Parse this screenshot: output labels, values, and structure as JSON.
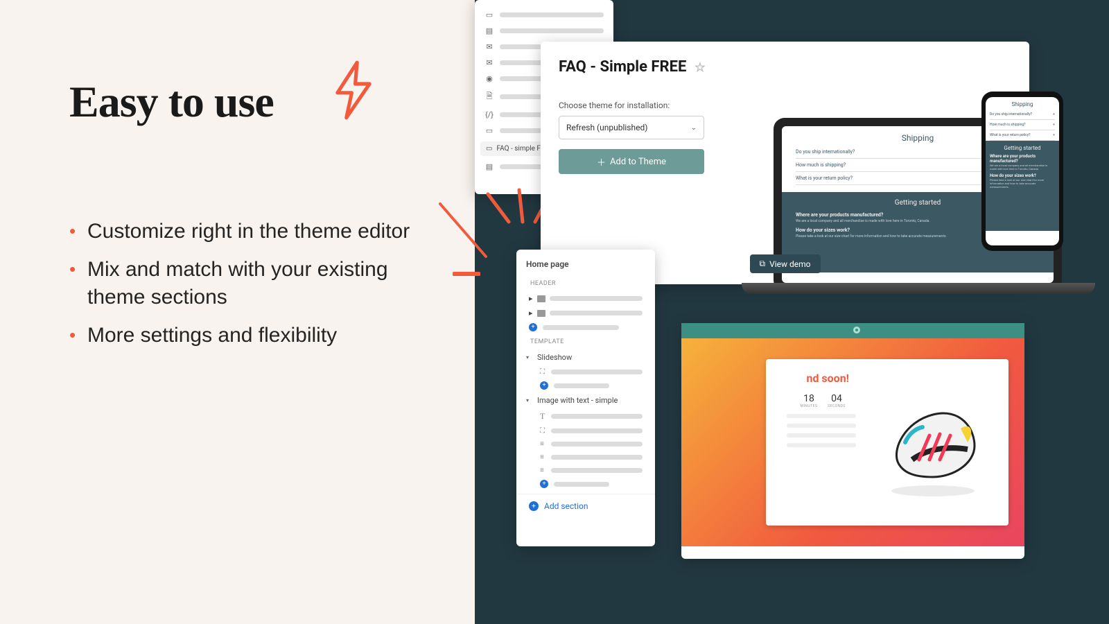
{
  "headline": "Easy to use",
  "bullets": [
    "Customize right in the theme editor",
    "Mix and match with your existing theme sections",
    "More settings and flexibility"
  ],
  "install": {
    "title": "FAQ - Simple FREE",
    "choose_label": "Choose theme for installation:",
    "selected_theme": "Refresh (unpublished)",
    "add_button": "Add to Theme",
    "view_demo": "View demo"
  },
  "faq_preview": {
    "heading": "Shipping",
    "rows": [
      "Do you ship internationally?",
      "How much is shipping?",
      "What is your return policy?"
    ],
    "dark": {
      "heading": "Getting started",
      "q1": "Where are your products manufactured?",
      "a1": "We are a local company and all merchandise is made with love here in Toronto, Canada.",
      "q2": "How do your sizes work?",
      "a2": "Please take a look at our size chart for more information and how to take accurate measurements."
    }
  },
  "editor": {
    "title": "Home page",
    "header_label": "HEADER",
    "template_label": "TEMPLATE",
    "slideshow": "Slideshow",
    "imgtext": "Image with text - simple",
    "add_section": "Add section",
    "faq_section": "FAQ - simple FREE"
  },
  "demo": {
    "headline": "nd soon!",
    "tile1_num": "18",
    "tile1_lbl": "MINUTES",
    "tile2_num": "04",
    "tile2_lbl": "SECONDS"
  },
  "colors": {
    "accent": "#f25a3c",
    "teal": "#6d9b97",
    "dark": "#223841"
  }
}
